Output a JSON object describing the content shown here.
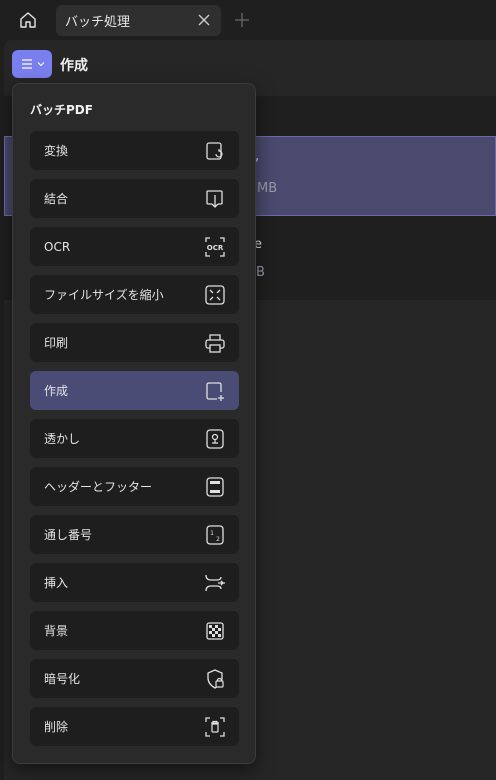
{
  "tabbar": {
    "tab_label": "バッチ処理"
  },
  "header": {
    "title": "作成"
  },
  "background_rows": {
    "row1_fragment_a": ",",
    "row1_fragment_b": "MB",
    "row2_fragment_a": "e",
    "row2_fragment_b": "B"
  },
  "dropdown": {
    "title": "バッチPDF",
    "items": [
      {
        "label": "変換",
        "icon": "convert-icon"
      },
      {
        "label": "結合",
        "icon": "combine-icon"
      },
      {
        "label": "OCR",
        "icon": "ocr-icon"
      },
      {
        "label": "ファイルサイズを縮小",
        "icon": "compress-icon"
      },
      {
        "label": "印刷",
        "icon": "print-icon"
      },
      {
        "label": "作成",
        "icon": "create-icon",
        "active": true
      },
      {
        "label": "透かし",
        "icon": "watermark-icon"
      },
      {
        "label": "ヘッダーとフッター",
        "icon": "header-footer-icon"
      },
      {
        "label": "通し番号",
        "icon": "bates-number-icon"
      },
      {
        "label": "挿入",
        "icon": "insert-icon"
      },
      {
        "label": "背景",
        "icon": "background-icon"
      },
      {
        "label": "暗号化",
        "icon": "encrypt-icon"
      },
      {
        "label": "削除",
        "icon": "delete-icon"
      }
    ]
  },
  "colors": {
    "accent": "#7a7ff0",
    "active_item": "#4b4c75",
    "selected_row": "#494a6d"
  }
}
